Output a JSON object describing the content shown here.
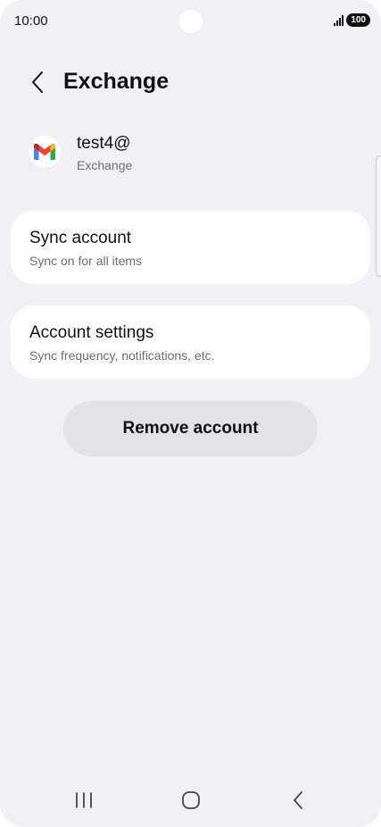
{
  "status_bar": {
    "time": "10:00",
    "battery": "100"
  },
  "header": {
    "title": "Exchange",
    "back_icon": "chevron-left-icon"
  },
  "account": {
    "email": "test4@",
    "type": "Exchange",
    "logo_icon": "gmail-logo"
  },
  "cards": {
    "sync": {
      "title": "Sync account",
      "subtitle": "Sync on for all items"
    },
    "settings": {
      "title": "Account settings",
      "subtitle": "Sync frequency, notifications, etc."
    }
  },
  "remove_button": {
    "label": "Remove account"
  },
  "nav": {
    "recents_icon": "recents-icon",
    "home_icon": "home-icon",
    "back_icon": "back-icon"
  },
  "colors": {
    "background": "#f1f1f3",
    "card": "#ffffff",
    "button": "#e3e3e6",
    "text_primary": "#111111",
    "text_secondary": "#6e6e72"
  }
}
